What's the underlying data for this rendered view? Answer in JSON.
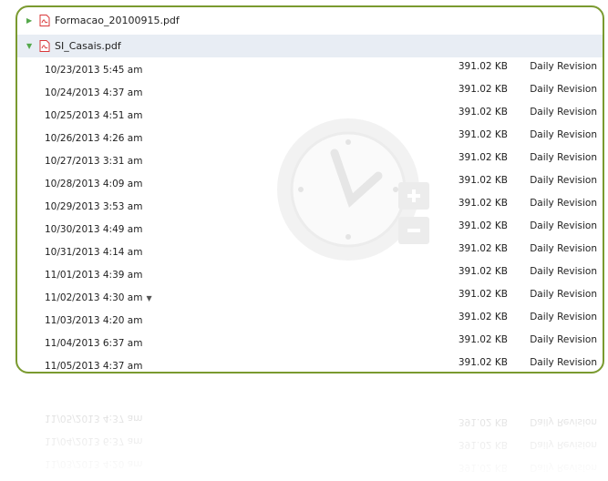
{
  "files": [
    {
      "name": "Formacao_20100915.pdf",
      "expanded": false
    },
    {
      "name": "SI_Casais.pdf",
      "expanded": true
    }
  ],
  "versions": [
    {
      "date": "10/23/2013 5:45 am",
      "size": "391.02 KB",
      "type": "Daily Revision"
    },
    {
      "date": "10/24/2013 4:37 am",
      "size": "391.02 KB",
      "type": "Daily Revision"
    },
    {
      "date": "10/25/2013 4:51 am",
      "size": "391.02 KB",
      "type": "Daily Revision"
    },
    {
      "date": "10/26/2013 4:26 am",
      "size": "391.02 KB",
      "type": "Daily Revision"
    },
    {
      "date": "10/27/2013 3:31 am",
      "size": "391.02 KB",
      "type": "Daily Revision"
    },
    {
      "date": "10/28/2013 4:09 am",
      "size": "391.02 KB",
      "type": "Daily Revision"
    },
    {
      "date": "10/29/2013 3:53 am",
      "size": "391.02 KB",
      "type": "Daily Revision"
    },
    {
      "date": "10/30/2013 4:49 am",
      "size": "391.02 KB",
      "type": "Daily Revision"
    },
    {
      "date": "10/31/2013 4:14 am",
      "size": "391.02 KB",
      "type": "Daily Revision"
    },
    {
      "date": "11/01/2013 4:39 am",
      "size": "391.02 KB",
      "type": "Daily Revision"
    },
    {
      "date": "11/02/2013 4:30 am",
      "size": "391.02 KB",
      "type": "Daily Revision"
    },
    {
      "date": "11/03/2013 4:20 am",
      "size": "391.02 KB",
      "type": "Daily Revision"
    },
    {
      "date": "11/04/2013 6:37 am",
      "size": "391.02 KB",
      "type": "Daily Revision"
    },
    {
      "date": "11/05/2013 4:37 am",
      "size": "391.02 KB",
      "type": "Daily Revision"
    }
  ],
  "colors": {
    "frame_border": "#7a9a2f",
    "selected_row": "#e8edf4",
    "arrow": "#54a84a",
    "pdf_red": "#d9383a"
  },
  "icons": {
    "collapsed": "triangle-right-icon",
    "expanded": "triangle-down-icon",
    "file": "pdf-file-icon",
    "watermark": "clock-restore-icon",
    "menu": "chevron-down-icon"
  }
}
